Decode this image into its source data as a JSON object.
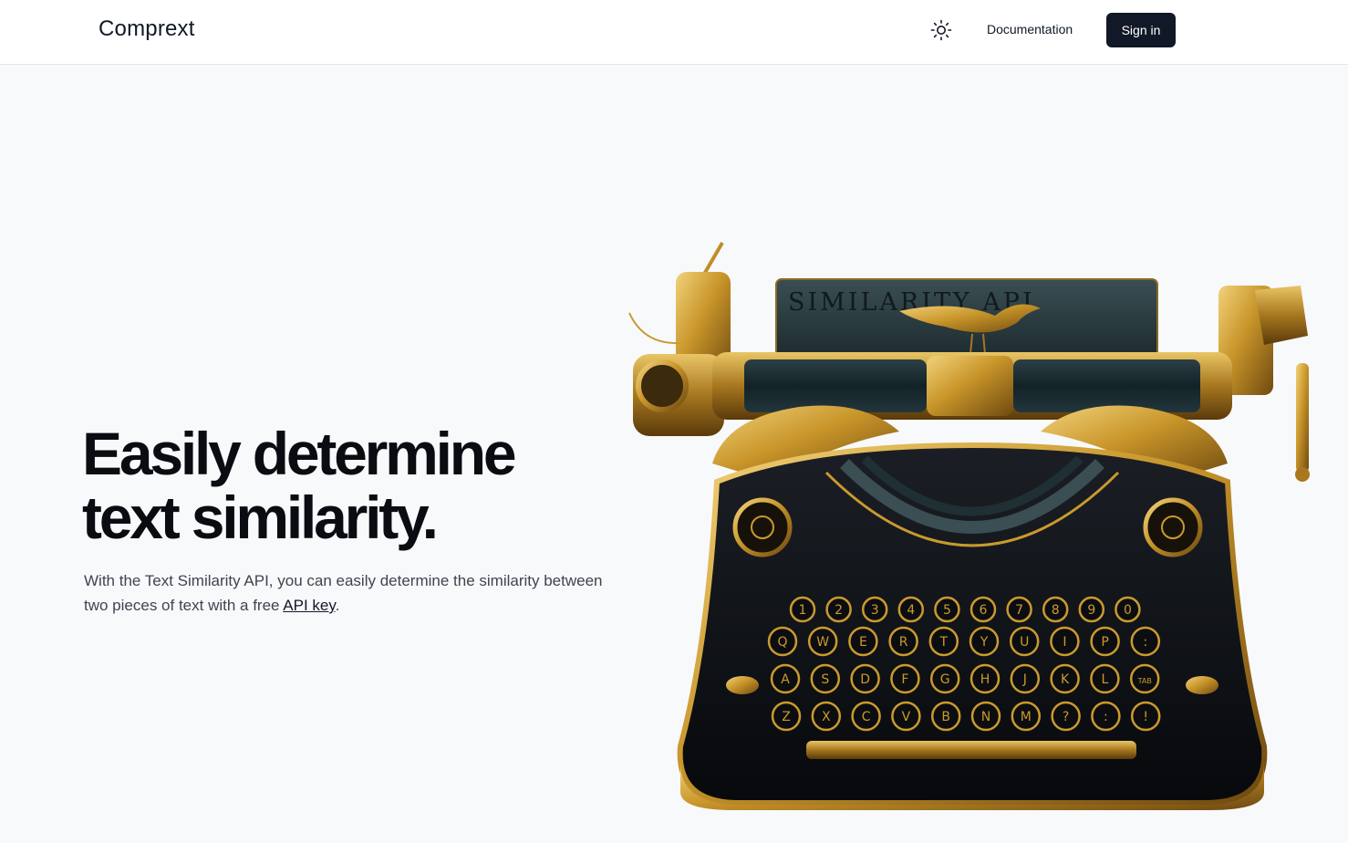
{
  "header": {
    "brand": "Comprext",
    "theme_toggle_icon": "sun-icon",
    "nav_documentation": "Documentation",
    "sign_in": "Sign in"
  },
  "hero": {
    "title_line1": "Easily determine",
    "title_line2": "text similarity.",
    "subtitle_before": "With the Text Similarity API, you can easily determine the similarity between two pieces of text with a free ",
    "subtitle_link": "API key",
    "subtitle_after": "."
  },
  "illustration": {
    "paper_text": "SIMILARITY API",
    "row1": [
      "1",
      "2",
      "3",
      "4",
      "5",
      "6",
      "7",
      "8",
      "9",
      "0"
    ],
    "row2": [
      "Q",
      "W",
      "E",
      "R",
      "T",
      "Y",
      "U",
      "I",
      "P",
      ":"
    ],
    "row3": [
      "A",
      "S",
      "D",
      "F",
      "G",
      "H",
      "J",
      "K",
      "L",
      "TAB"
    ],
    "row4": [
      "Z",
      "X",
      "C",
      "V",
      "B",
      "N",
      "M",
      "?",
      ":",
      "!"
    ]
  },
  "colors": {
    "header_bg": "#ffffff",
    "page_bg": "#f8f9fb",
    "button_bg": "#111827",
    "gold": "#c99a2e",
    "dark_teal": "#1f2f33"
  }
}
